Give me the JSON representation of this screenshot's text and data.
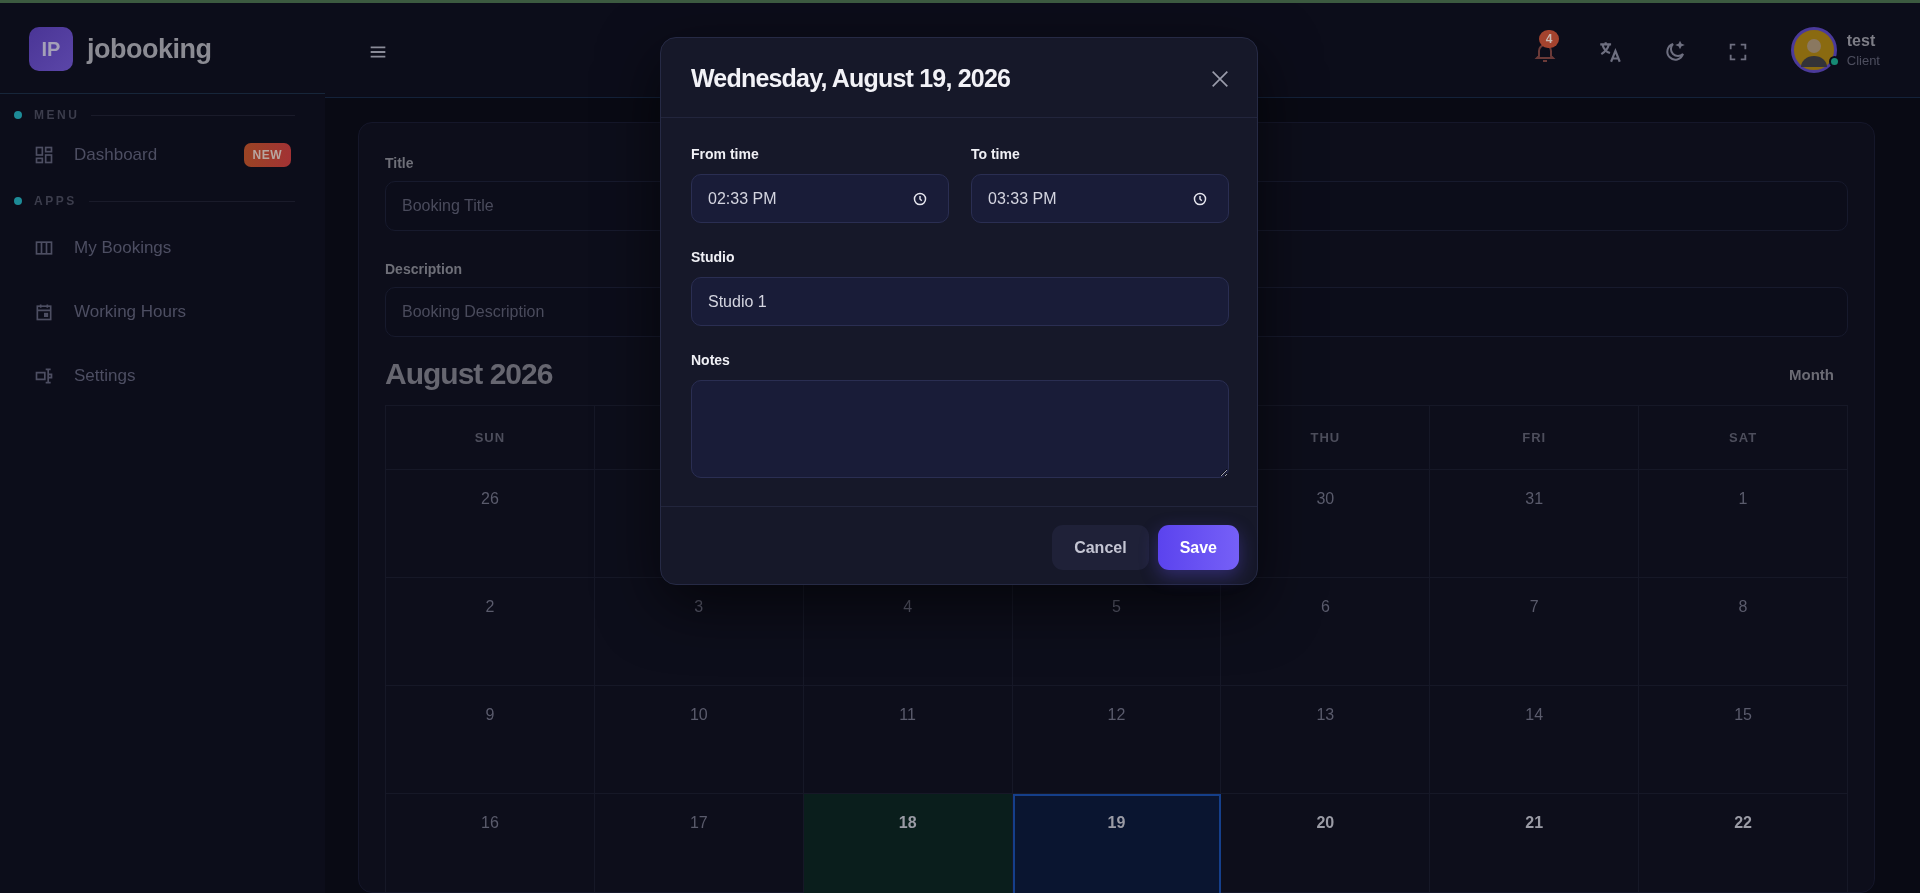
{
  "brand": {
    "logo": "IP",
    "name": "jobooking"
  },
  "sidebar": {
    "sections": [
      {
        "heading": "MENU",
        "items": [
          {
            "label": "Dashboard",
            "kind": "dashboard",
            "badge": "NEW"
          }
        ]
      },
      {
        "heading": "APPS",
        "items": [
          {
            "label": "My Bookings",
            "kind": "columns"
          },
          {
            "label": "Working Hours",
            "kind": "calendar"
          },
          {
            "label": "Settings",
            "kind": "settings"
          }
        ]
      }
    ]
  },
  "header": {
    "notification_count": "4",
    "user": {
      "name": "test",
      "role": "Client",
      "online": true
    }
  },
  "form": {
    "fields": [
      {
        "label": "Title",
        "placeholder": "Booking Title"
      },
      {
        "label": "Description",
        "placeholder": "Booking Description"
      }
    ]
  },
  "calendar": {
    "title": "August 2026",
    "view": "Month",
    "weekdays": [
      {
        "label": "SUN"
      },
      {
        "label": "THU"
      },
      {
        "label": "FRI"
      },
      {
        "label": "SAT"
      }
    ],
    "weeks": [
      [
        {
          "day": "26",
          "past": true,
          "today": false,
          "selected": false
        },
        {
          "day": "30",
          "past": true,
          "today": false,
          "selected": false
        },
        {
          "day": "31",
          "past": true,
          "today": false,
          "selected": false
        },
        {
          "day": "1",
          "past": true,
          "today": false,
          "selected": false
        }
      ],
      [
        {
          "day": "2",
          "past": true,
          "today": false,
          "selected": false
        },
        {
          "day": "3",
          "past": true,
          "today": false,
          "selected": false
        },
        {
          "day": "4",
          "past": true,
          "today": false,
          "selected": false
        },
        {
          "day": "5",
          "past": true,
          "today": false,
          "selected": false
        },
        {
          "day": "6",
          "past": true,
          "today": false,
          "selected": false
        },
        {
          "day": "7",
          "past": true,
          "today": false,
          "selected": false
        },
        {
          "day": "8",
          "past": true,
          "today": false,
          "selected": false
        }
      ],
      [
        {
          "day": "9",
          "past": true,
          "today": false,
          "selected": false
        },
        {
          "day": "10",
          "past": true,
          "today": false,
          "selected": false
        },
        {
          "day": "11",
          "past": true,
          "today": false,
          "selected": false
        },
        {
          "day": "12",
          "past": true,
          "today": false,
          "selected": false
        },
        {
          "day": "13",
          "past": true,
          "today": false,
          "selected": false
        },
        {
          "day": "14",
          "past": true,
          "today": false,
          "selected": false
        },
        {
          "day": "15",
          "past": true,
          "today": false,
          "selected": false
        }
      ],
      [
        {
          "day": "16",
          "past": true,
          "today": false,
          "selected": false
        },
        {
          "day": "17",
          "past": true,
          "today": false,
          "selected": false
        },
        {
          "day": "18",
          "past": false,
          "today": true,
          "selected": false
        },
        {
          "day": "19",
          "past": false,
          "today": false,
          "selected": true
        },
        {
          "day": "20",
          "past": false,
          "today": false,
          "selected": false
        },
        {
          "day": "21",
          "past": false,
          "today": false,
          "selected": false
        },
        {
          "day": "22",
          "past": false,
          "today": false,
          "selected": false
        }
      ]
    ]
  },
  "dialog": {
    "title": "Wednesday, August 19, 2026",
    "fields": [
      {
        "kind": "time",
        "label": "From time",
        "value": "02:33 PM"
      },
      {
        "kind": "time",
        "label": "To time",
        "value": "03:33 PM"
      },
      {
        "kind": "text",
        "label": "Studio",
        "value": "Studio 1"
      },
      {
        "kind": "textarea",
        "label": "Notes"
      }
    ],
    "buttons": [
      {
        "label": "Cancel",
        "kind": "secondary"
      },
      {
        "label": "Save",
        "kind": "primary"
      }
    ]
  }
}
